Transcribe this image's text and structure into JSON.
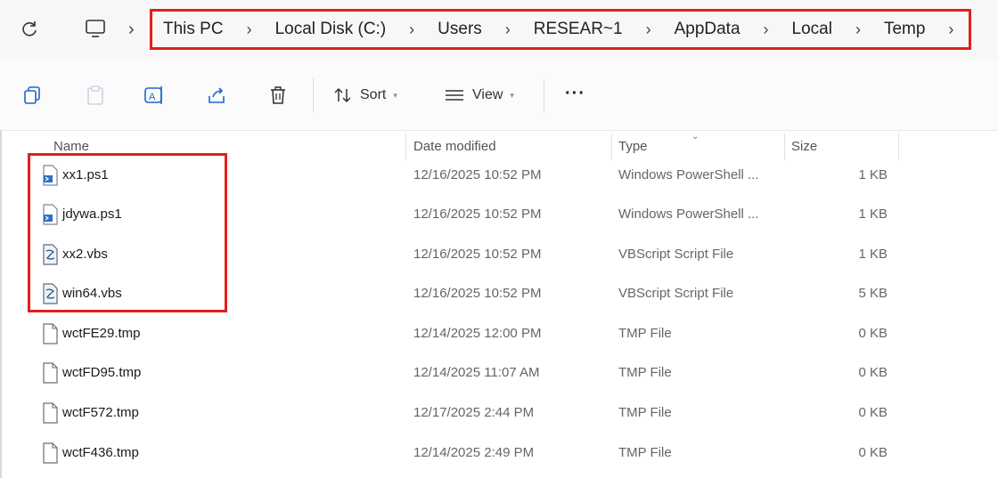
{
  "address_bar": {
    "refresh_icon": "refresh-icon",
    "pc_icon": "monitor-icon",
    "breadcrumbs": [
      "This PC",
      "Local Disk (C:)",
      "Users",
      "RESEAR~1",
      "AppData",
      "Local",
      "Temp"
    ],
    "separator": "›"
  },
  "toolbar": {
    "icons": [
      "copy-icon",
      "paste-icon",
      "rename-icon",
      "share-icon",
      "delete-icon"
    ],
    "sort_label": "Sort",
    "view_label": "View",
    "more_label": "···"
  },
  "columns": {
    "name": "Name",
    "date": "Date modified",
    "type": "Type",
    "size": "Size"
  },
  "files": [
    {
      "name": "xx1.ps1",
      "date": "12/16/2025 10:52 PM",
      "type": "Windows PowerShell ...",
      "size": "1 KB",
      "icon": "powershell-file-icon"
    },
    {
      "name": "jdywa.ps1",
      "date": "12/16/2025 10:52 PM",
      "type": "Windows PowerShell ...",
      "size": "1 KB",
      "icon": "powershell-file-icon"
    },
    {
      "name": "xx2.vbs",
      "date": "12/16/2025 10:52 PM",
      "type": "VBScript Script File",
      "size": "1 KB",
      "icon": "vbscript-file-icon"
    },
    {
      "name": "win64.vbs",
      "date": "12/16/2025 10:52 PM",
      "type": "VBScript Script File",
      "size": "5 KB",
      "icon": "vbscript-file-icon"
    },
    {
      "name": "wctFE29.tmp",
      "date": "12/14/2025 12:00 PM",
      "type": "TMP File",
      "size": "0 KB",
      "icon": "blank-file-icon"
    },
    {
      "name": "wctFD95.tmp",
      "date": "12/14/2025 11:07 AM",
      "type": "TMP File",
      "size": "0 KB",
      "icon": "blank-file-icon"
    },
    {
      "name": "wctF572.tmp",
      "date": "12/17/2025 2:44 PM",
      "type": "TMP File",
      "size": "0 KB",
      "icon": "blank-file-icon"
    },
    {
      "name": "wctF436.tmp",
      "date": "12/14/2025 2:49 PM",
      "type": "TMP File",
      "size": "0 KB",
      "icon": "blank-file-icon"
    }
  ],
  "colors": {
    "highlight": "#e0201c",
    "accent": "#1e66c9"
  }
}
